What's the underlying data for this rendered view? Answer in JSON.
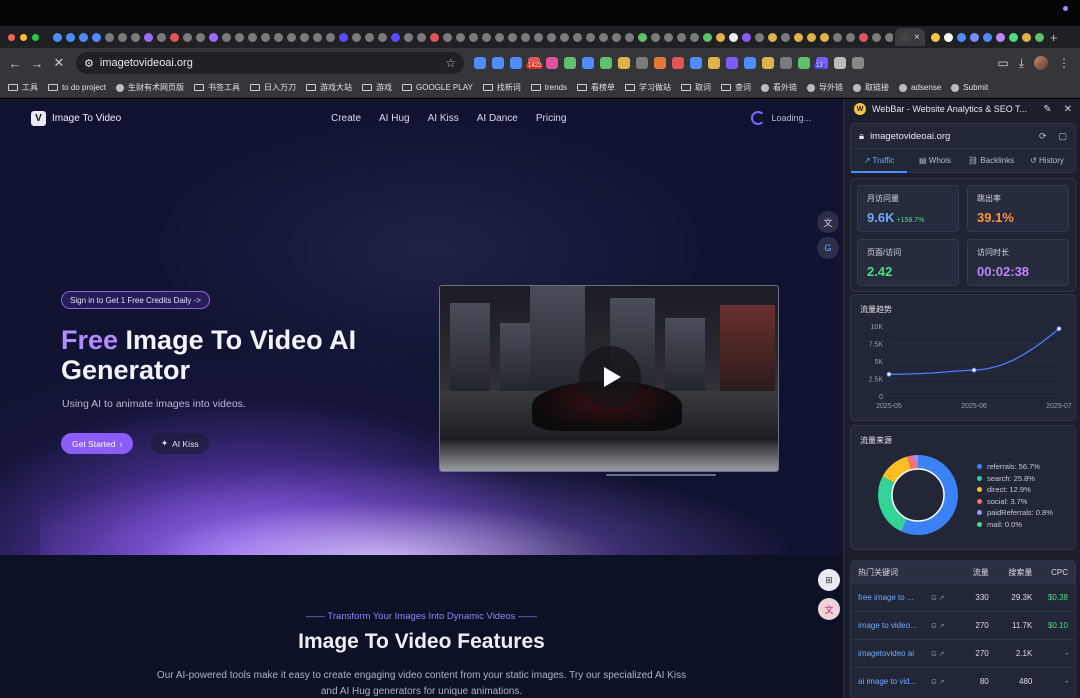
{
  "browser": {
    "url": "imagetovideoai.org",
    "active_tab_close": "×",
    "new_tab": "+",
    "ext_badge": "1422",
    "ext_badge2": "13",
    "bookmarks": [
      "工具",
      "to do project",
      "生财有术网页版",
      "书签工具",
      "日入万刀",
      "游戏大站",
      "游戏",
      "GOOGLE PLAY",
      "找新词",
      "trends",
      "看榜单",
      "学习做站",
      "取词",
      "查词",
      "看外链",
      "导外链",
      "取链接",
      "adsense",
      "Submit"
    ],
    "colors": {
      "accent": "#8b5cf6"
    }
  },
  "site": {
    "logo_text": "Image To Video",
    "nav": [
      "Create",
      "AI Hug",
      "AI Kiss",
      "AI Dance",
      "Pricing"
    ],
    "loading": "Loading...",
    "pill": "Sign in to Get 1 Free Credits Daily ->",
    "h1_accent": "Free",
    "h1_rest": " Image To Video AI Generator",
    "subtitle": "Using AI to animate images into videos.",
    "btn_start": "Get Started",
    "btn_kiss": "AI Kiss",
    "section_kicker": "Transform Your Images Into Dynamic Videos",
    "section_title": "Image To Video Features",
    "section_desc": "Our AI-powered tools make it easy to create engaging video content from your static images. Try our specialized AI Kiss and AI Hug generators for unique animations."
  },
  "panel": {
    "title": "WebBar - Website Analytics & SEO T...",
    "domain": "imagetovideoai.org",
    "tabs": [
      "Traffic",
      "Whois",
      "Backlinks",
      "History"
    ],
    "stats": [
      {
        "label": "月访问量",
        "value": "9.6K",
        "change": "+158.7%",
        "color": "#6ea8ff"
      },
      {
        "label": "跳出率",
        "value": "39.1%",
        "change": "",
        "color": "#fb923c"
      },
      {
        "label": "页面/访问",
        "value": "2.42",
        "change": "",
        "color": "#4ade80"
      },
      {
        "label": "访问时长",
        "value": "00:02:38",
        "color": "#c084fc",
        "change": ""
      }
    ],
    "trend_title": "流量趋势",
    "source_title": "流量来源",
    "kw_title": "热门关键词",
    "kw_cols": [
      "流量",
      "搜索量",
      "CPC"
    ],
    "keywords": [
      {
        "kw": "free image to ...",
        "traffic": "330",
        "volume": "29.3K",
        "cpc": "$0.38"
      },
      {
        "kw": "image to video...",
        "traffic": "270",
        "volume": "11.7K",
        "cpc": "$0.10"
      },
      {
        "kw": "imagetovideo ai",
        "traffic": "270",
        "volume": "2.1K",
        "cpc": "-"
      },
      {
        "kw": "ai image to vid...",
        "traffic": "80",
        "volume": "480",
        "cpc": "-"
      }
    ]
  },
  "chart_data": [
    {
      "type": "line",
      "title": "流量趋势",
      "x": [
        "2025-05",
        "2025-06",
        "2025-07"
      ],
      "series": [
        {
          "values": [
            3100,
            3700,
            9600
          ]
        }
      ],
      "ylim": [
        0,
        10000
      ],
      "yticks": [
        "10K",
        "7.5K",
        "5K",
        "2.5K",
        "0"
      ],
      "grid": true
    },
    {
      "type": "pie",
      "title": "流量来源",
      "categories": [
        "referrals",
        "search",
        "direct",
        "social",
        "paidReferrals",
        "mail"
      ],
      "values": [
        56.7,
        25.8,
        12.9,
        3.7,
        0.8,
        0.0
      ],
      "labels": [
        "referrals: 56.7%",
        "search: 25.8%",
        "direct: 12.9%",
        "social: 3.7%",
        "paidReferrals: 0.8%",
        "mail: 0.0%"
      ],
      "colors": [
        "#3b82f6",
        "#34d399",
        "#fbbf24",
        "#f87171",
        "#a78bfa",
        "#4ade80"
      ],
      "legend": "right"
    }
  ]
}
